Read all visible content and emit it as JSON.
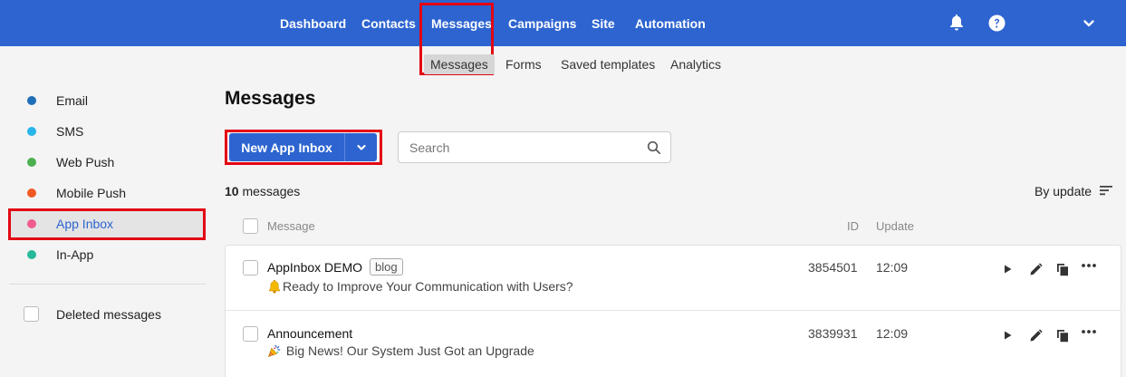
{
  "topnav": {
    "items": [
      "Dashboard",
      "Contacts",
      "Messages",
      "Campaigns",
      "Site",
      "Automation"
    ],
    "active": "Messages",
    "icons": [
      "bell-icon",
      "help-icon",
      "chevron-down-icon"
    ]
  },
  "subnav": {
    "items": [
      "Messages",
      "Forms",
      "Saved templates",
      "Analytics"
    ],
    "active": "Messages"
  },
  "sidebar": {
    "items": [
      {
        "label": "Email",
        "color": "#1f6fb8"
      },
      {
        "label": "SMS",
        "color": "#27b6ea"
      },
      {
        "label": "Web Push",
        "color": "#4caf50"
      },
      {
        "label": "Mobile Push",
        "color": "#f05a22"
      },
      {
        "label": "App Inbox",
        "color": "#ef5c8f"
      },
      {
        "label": "In-App",
        "color": "#26b99a"
      }
    ],
    "active": "App Inbox",
    "deleted_label": "Deleted messages"
  },
  "main": {
    "title": "Messages",
    "new_button_label": "New App Inbox",
    "search_placeholder": "Search",
    "count_number": "10",
    "count_label": " messages",
    "sort_label": "By update",
    "columns": {
      "message": "Message",
      "id": "ID",
      "update": "Update"
    },
    "rows": [
      {
        "title": "AppInbox DEMO",
        "tag": "blog",
        "subtitle": "Ready to Improve Your Communication with Users?",
        "emoji": "bell-emoji",
        "id": "3854501",
        "update": "12:09"
      },
      {
        "title": "Announcement",
        "tag": "",
        "subtitle": " Big News! Our System Just Got an Upgrade",
        "emoji": "party-popper-emoji",
        "id": "3839931",
        "update": "12:09"
      }
    ]
  },
  "colors": {
    "brand": "#2d64d0",
    "highlight": "#e30613"
  }
}
